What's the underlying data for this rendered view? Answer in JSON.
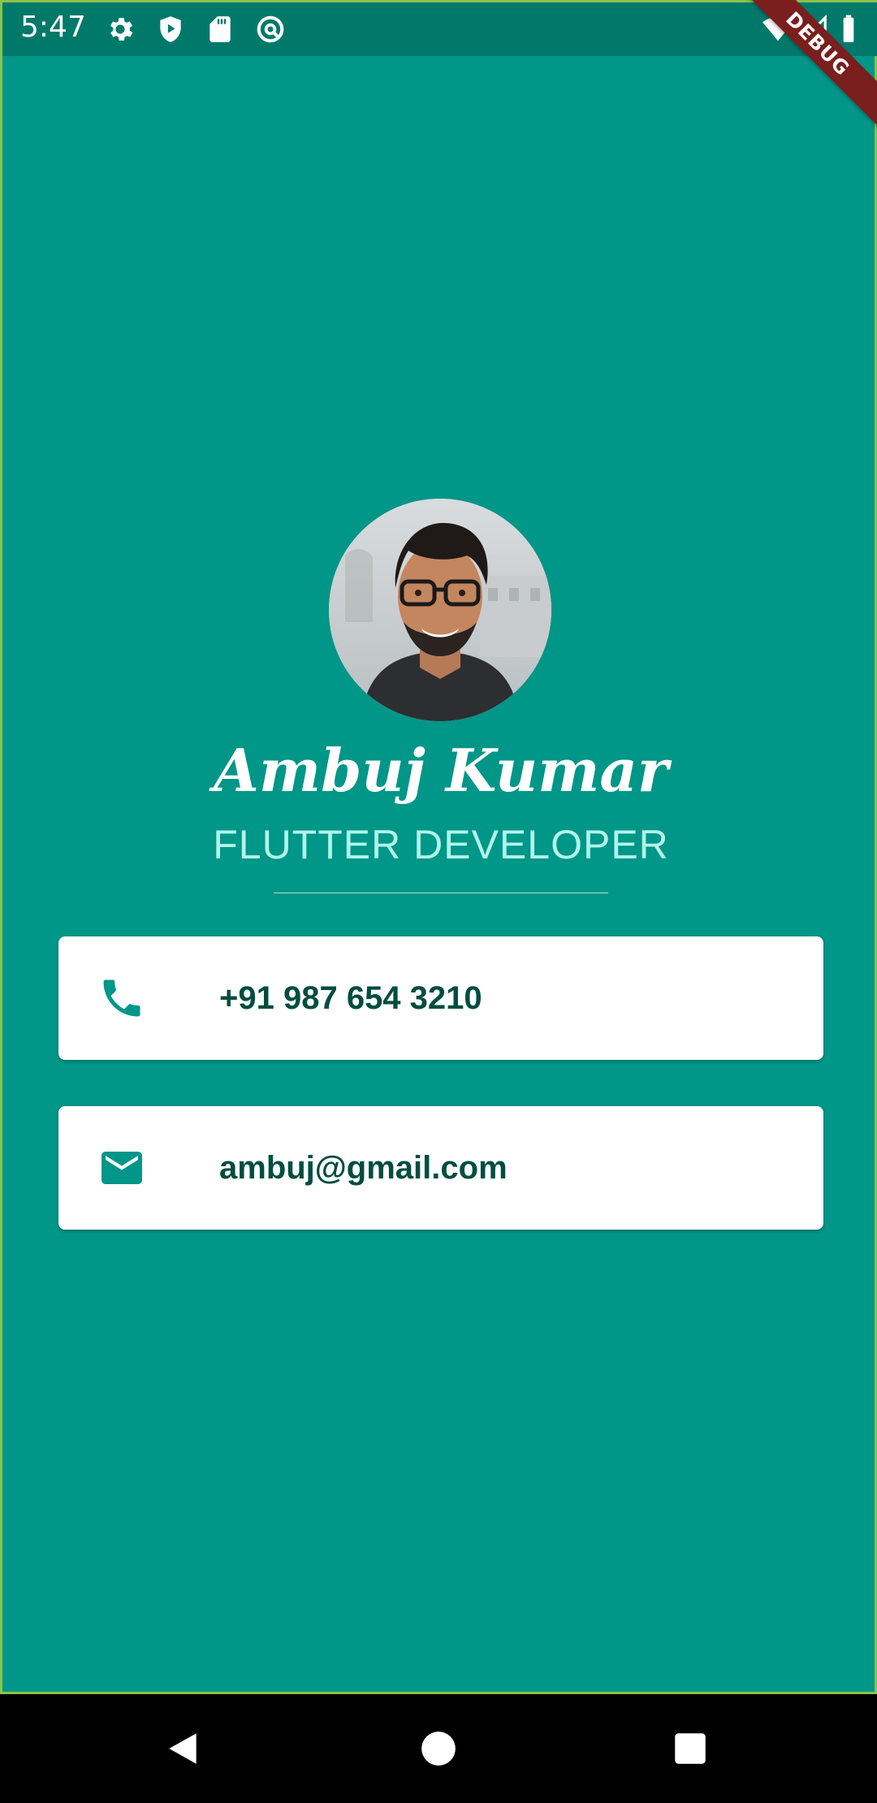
{
  "status_bar": {
    "time": "5:47",
    "left_icons": [
      "gear-icon",
      "shield-play-icon",
      "sd-card-icon",
      "vpn-icon"
    ],
    "right_icons": [
      "wifi-icon",
      "signal-icon",
      "battery-icon"
    ]
  },
  "debug_banner": {
    "label": "DEBUG"
  },
  "profile": {
    "name": "Ambuj Kumar",
    "title": "FLUTTER DEVELOPER"
  },
  "contacts": [
    {
      "icon": "phone-icon",
      "value": "+91 987 654 3210"
    },
    {
      "icon": "mail-icon",
      "value": "ambuj@gmail.com"
    }
  ],
  "colors": {
    "background": "#009688",
    "status_bar": "#00796b",
    "accent_text": "#b2f5ea",
    "card_text": "#004d40",
    "icon": "#009688"
  }
}
